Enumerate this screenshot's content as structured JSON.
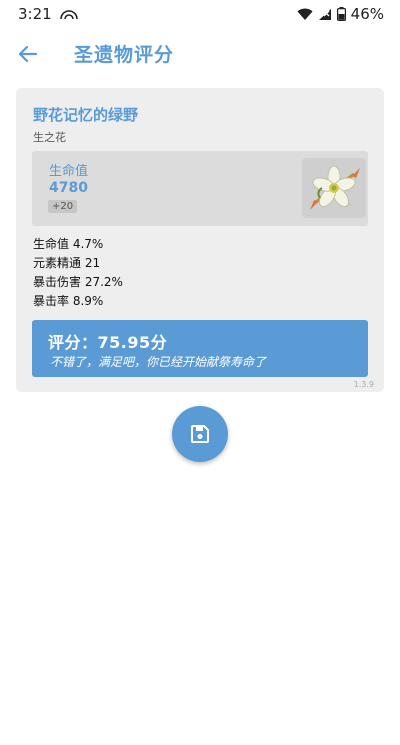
{
  "status": {
    "time": "3:21",
    "battery": "46%"
  },
  "app_bar": {
    "title": "圣遗物评分"
  },
  "artifact": {
    "name": "野花记忆的绿野",
    "slot": "生之花",
    "main_stat": {
      "label": "生命值",
      "value": "4780",
      "level": "+20"
    },
    "sub_stats": [
      "生命值 4.7%",
      "元素精通 21",
      "暴击伤害 27.2%",
      "暴击率 8.9%"
    ]
  },
  "score": {
    "line": "评分：75.95分",
    "comment": "不错了，满足吧，你已经开始献祭寿命了"
  },
  "version": "1.3.9",
  "colors": {
    "accent": "#5b9bd5",
    "card_bg": "#eeeeee",
    "main_stat_bg": "#dcdcdc"
  },
  "icons": {
    "back": "arrow-left-icon",
    "save": "save-icon",
    "artifact": "flower-of-life-icon"
  }
}
